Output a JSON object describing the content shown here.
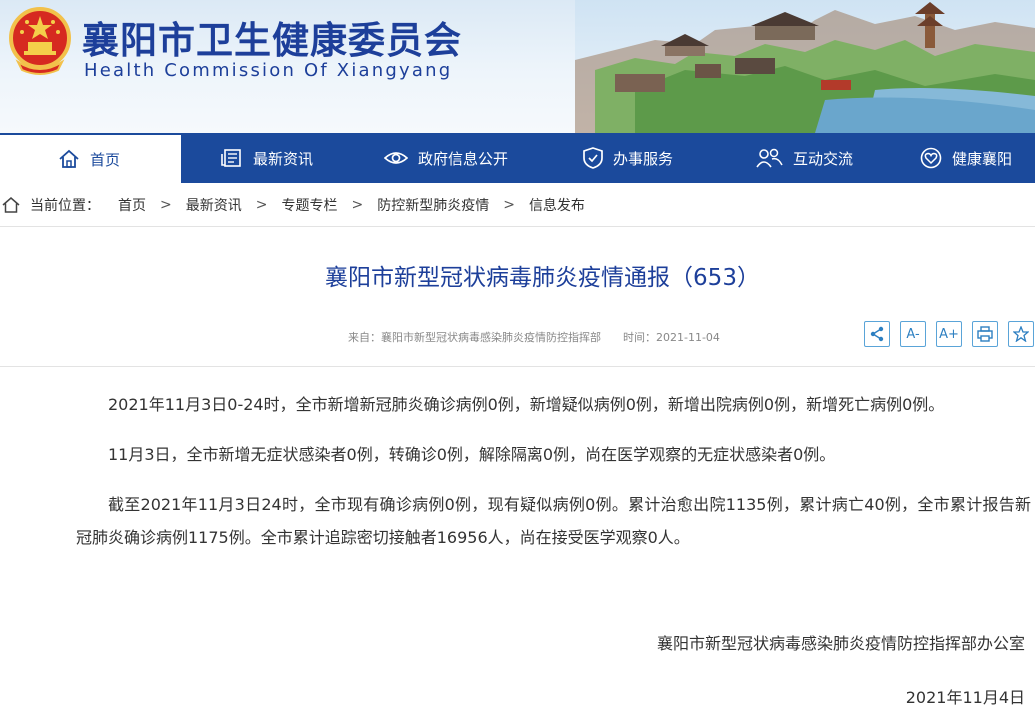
{
  "header": {
    "title": "襄阳市卫生健康委员会",
    "subtitle": "Health Commission Of Xiangyang"
  },
  "nav": {
    "items": [
      {
        "label": "首页",
        "icon": "home-icon"
      },
      {
        "label": "最新资讯",
        "icon": "newspaper-icon"
      },
      {
        "label": "政府信息公开",
        "icon": "eye-icon"
      },
      {
        "label": "办事服务",
        "icon": "shield-icon"
      },
      {
        "label": "互动交流",
        "icon": "people-icon"
      },
      {
        "label": "健康襄阳",
        "icon": "heart-badge-icon"
      }
    ]
  },
  "breadcrumb": {
    "lead": "当前位置：",
    "items": [
      "首页",
      "最新资讯",
      "专题专栏",
      "防控新型肺炎疫情",
      "信息发布"
    ],
    "separator": ">"
  },
  "article": {
    "title": "襄阳市新型冠状病毒肺炎疫情通报（653）",
    "source_label": "来自：襄阳市新型冠状病毒感染肺炎疫情防控指挥部",
    "time_label": "时间：2021-11-04",
    "tools": {
      "share": "share-icon",
      "font_decrease": "A-",
      "font_increase": "A+",
      "print": "print-icon",
      "favorite": "star-icon"
    },
    "paragraphs": [
      "2021年11月3日0-24时，全市新增新冠肺炎确诊病例0例，新增疑似病例0例，新增出院病例0例，新增死亡病例0例。",
      "11月3日，全市新增无症状感染者0例，转确诊0例，解除隔离0例，尚在医学观察的无症状感染者0例。",
      "截至2021年11月3日24时，全市现有确诊病例0例，现有疑似病例0例。累计治愈出院1135例，累计病亡40例，全市累计报告新冠肺炎确诊病例1175例。全市累计追踪密切接触者16956人，尚在接受医学观察0人。"
    ],
    "signature": "襄阳市新型冠状病毒感染肺炎疫情防控指挥部办公室",
    "date": "2021年11月4日"
  },
  "colors": {
    "brand_blue": "#1b4a9c",
    "title_blue": "#1d3f9a",
    "tool_border": "#5aa4d8"
  }
}
